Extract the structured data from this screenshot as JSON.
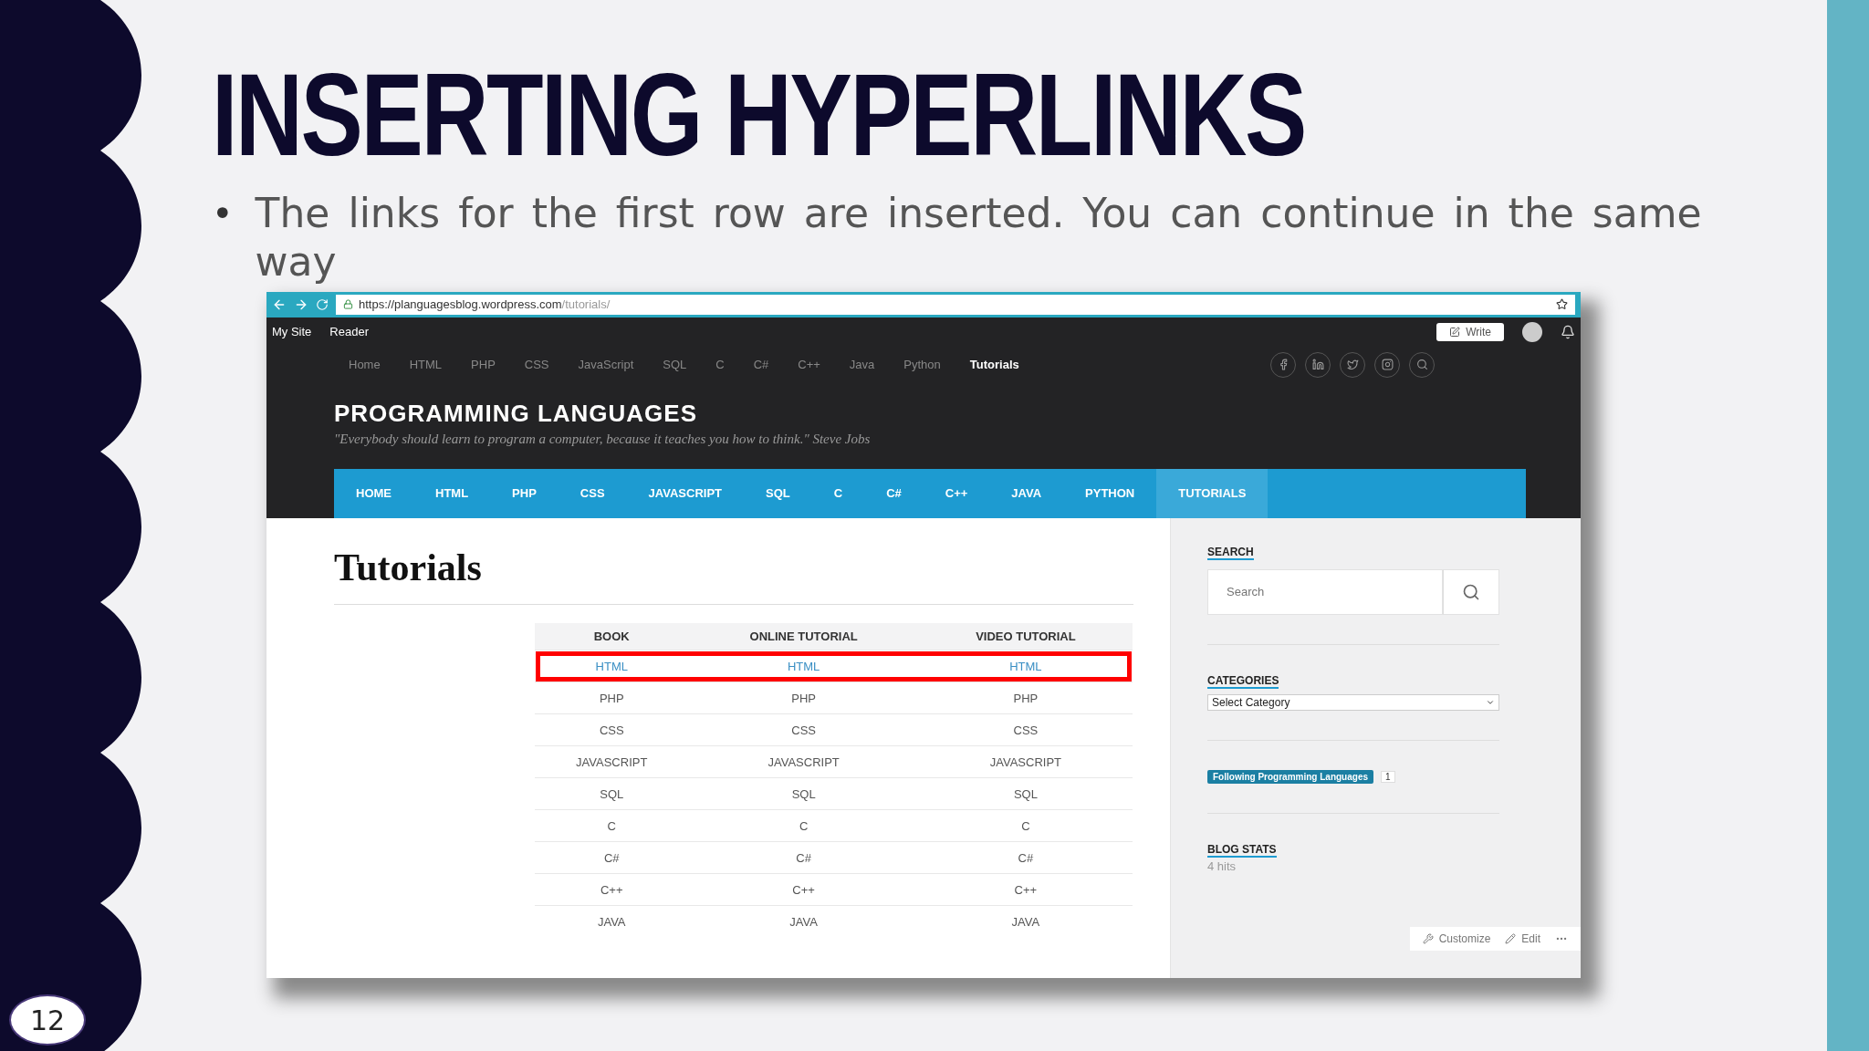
{
  "slide": {
    "title": "INSERTING HYPERLINKS",
    "bullets": [
      {
        "marker": "•",
        "text": "The links for the first row are inserted. You can continue in the same way"
      }
    ],
    "page_number": "12"
  },
  "browser": {
    "url_host": "https://planguagesblog.wordpress.com",
    "url_path": "/tutorials/"
  },
  "admin_bar": {
    "items": [
      "My Site",
      "Reader"
    ],
    "write_button": "Write"
  },
  "top_nav": [
    {
      "label": "Home",
      "selected": false
    },
    {
      "label": "HTML",
      "selected": false
    },
    {
      "label": "PHP",
      "selected": false
    },
    {
      "label": "CSS",
      "selected": false
    },
    {
      "label": "JavaScript",
      "selected": false
    },
    {
      "label": "SQL",
      "selected": false
    },
    {
      "label": "C",
      "selected": false
    },
    {
      "label": "C#",
      "selected": false
    },
    {
      "label": "C++",
      "selected": false
    },
    {
      "label": "Java",
      "selected": false
    },
    {
      "label": "Python",
      "selected": false
    },
    {
      "label": "Tutorials",
      "selected": true
    }
  ],
  "site": {
    "title": "PROGRAMMING LANGUAGES",
    "tagline": "\"Everybody should learn to program a computer, because it teaches you how to think.\" Steve Jobs"
  },
  "main_nav": [
    {
      "label": "HOME",
      "selected": false
    },
    {
      "label": "HTML",
      "selected": false
    },
    {
      "label": "PHP",
      "selected": false
    },
    {
      "label": "CSS",
      "selected": false
    },
    {
      "label": "JAVASCRIPT",
      "selected": false
    },
    {
      "label": "SQL",
      "selected": false
    },
    {
      "label": "C",
      "selected": false
    },
    {
      "label": "C#",
      "selected": false
    },
    {
      "label": "C++",
      "selected": false
    },
    {
      "label": "JAVA",
      "selected": false
    },
    {
      "label": "PYTHON",
      "selected": false
    },
    {
      "label": "TUTORIALS",
      "selected": true
    }
  ],
  "page_title": "Tutorials",
  "table": {
    "columns": [
      "BOOK",
      "ONLINE TUTORIAL",
      "VIDEO TUTORIAL"
    ],
    "rows": [
      {
        "cells": [
          "HTML",
          "HTML",
          "HTML"
        ],
        "link": true,
        "highlighted": true
      },
      {
        "cells": [
          "PHP",
          "PHP",
          "PHP"
        ],
        "link": false,
        "highlighted": false
      },
      {
        "cells": [
          "CSS",
          "CSS",
          "CSS"
        ],
        "link": false,
        "highlighted": false
      },
      {
        "cells": [
          "JAVASCRIPT",
          "JAVASCRIPT",
          "JAVASCRIPT"
        ],
        "link": false,
        "highlighted": false
      },
      {
        "cells": [
          "SQL",
          "SQL",
          "SQL"
        ],
        "link": false,
        "highlighted": false
      },
      {
        "cells": [
          "C",
          "C",
          "C"
        ],
        "link": false,
        "highlighted": false
      },
      {
        "cells": [
          "C#",
          "C#",
          "C#"
        ],
        "link": false,
        "highlighted": false
      },
      {
        "cells": [
          "C++",
          "C++",
          "C++"
        ],
        "link": false,
        "highlighted": false
      },
      {
        "cells": [
          "JAVA",
          "JAVA",
          "JAVA"
        ],
        "link": false,
        "highlighted": false
      }
    ]
  },
  "sidebar": {
    "search_title": "SEARCH",
    "search_placeholder": "Search",
    "categories_title": "CATEGORIES",
    "category_select": "Select Category",
    "follow_button": "Following Programming Languages",
    "follow_count": "1",
    "stats_title": "BLOG STATS",
    "stats_value": "4 hits"
  },
  "footer_bar": {
    "customize": "Customize",
    "edit": "Edit"
  }
}
